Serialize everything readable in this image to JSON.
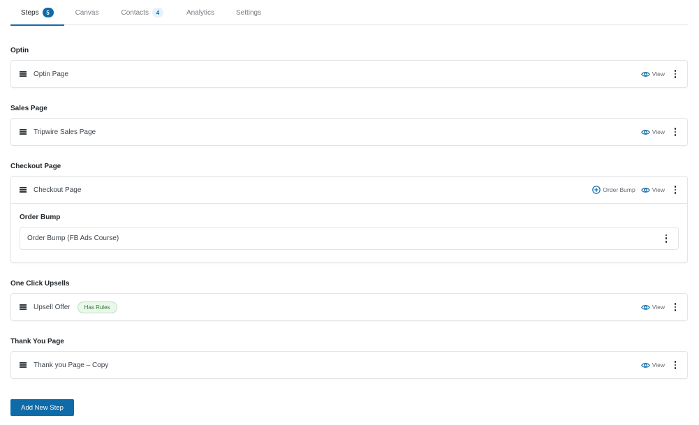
{
  "tabs": [
    {
      "label": "Steps",
      "count": "5",
      "active": true
    },
    {
      "label": "Canvas"
    },
    {
      "label": "Contacts",
      "count": "4"
    },
    {
      "label": "Analytics"
    },
    {
      "label": "Settings"
    }
  ],
  "groups": [
    {
      "title": "Optin",
      "steps": [
        {
          "name": "Optin Page",
          "view_label": "View"
        }
      ]
    },
    {
      "title": "Sales Page",
      "steps": [
        {
          "name": "Tripwire Sales Page",
          "view_label": "View"
        }
      ]
    },
    {
      "title": "Checkout Page",
      "steps": [
        {
          "name": "Checkout Page",
          "order_bump_label": "Order Bump",
          "view_label": "View",
          "order_bump_section": {
            "title": "Order Bump",
            "items": [
              {
                "name": "Order Bump (FB Ads Course)"
              }
            ]
          }
        }
      ]
    },
    {
      "title": "One Click Upsells",
      "steps": [
        {
          "name": "Upsell Offer",
          "badge": "Has Rules",
          "view_label": "View"
        }
      ]
    },
    {
      "title": "Thank You Page",
      "steps": [
        {
          "name": "Thank you Page – Copy",
          "view_label": "View"
        }
      ]
    }
  ],
  "colors": {
    "accent": "#0e6ba8",
    "badge_green": "#2e7d32"
  },
  "add_step_label": "Add New Step"
}
